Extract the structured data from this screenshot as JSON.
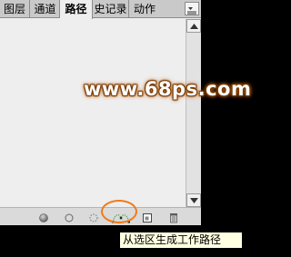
{
  "panel": {
    "tabs": [
      {
        "label": "图层"
      },
      {
        "label": "通道"
      },
      {
        "label": "路径"
      },
      {
        "label": "史记录"
      },
      {
        "label": "动作"
      }
    ],
    "active_tab": "路径"
  },
  "watermark": "www.68ps.com",
  "footer": {
    "buttons": [
      {
        "icon": "fill-path-icon"
      },
      {
        "icon": "stroke-path-icon"
      },
      {
        "icon": "load-path-as-selection-icon"
      },
      {
        "icon": "make-work-path-from-selection-icon"
      },
      {
        "icon": "create-new-path-icon"
      },
      {
        "icon": "delete-path-icon"
      }
    ]
  },
  "tooltip": "从选区生成工作路径",
  "colors": {
    "highlight": "#f07a19",
    "tooltip_bg": "#ffffe1"
  }
}
